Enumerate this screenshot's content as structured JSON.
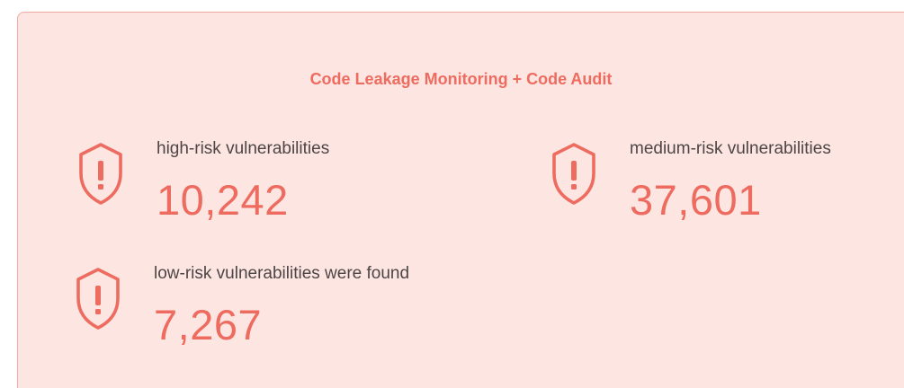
{
  "panel": {
    "title": "Code Leakage Monitoring + Code Audit",
    "background_color": "#fde6e2",
    "accent_color": "#ee6b60",
    "border_color": "#f3a9a1"
  },
  "stats": {
    "high": {
      "label": "high-risk vulnerabilities",
      "value": "10,242",
      "icon": "shield-alert-icon"
    },
    "medium": {
      "label": "medium-risk vulnerabilities",
      "value": "37,601",
      "icon": "shield-alert-icon"
    },
    "low": {
      "label": "low-risk vulnerabilities were found",
      "value": "7,267",
      "icon": "shield-alert-icon"
    }
  }
}
